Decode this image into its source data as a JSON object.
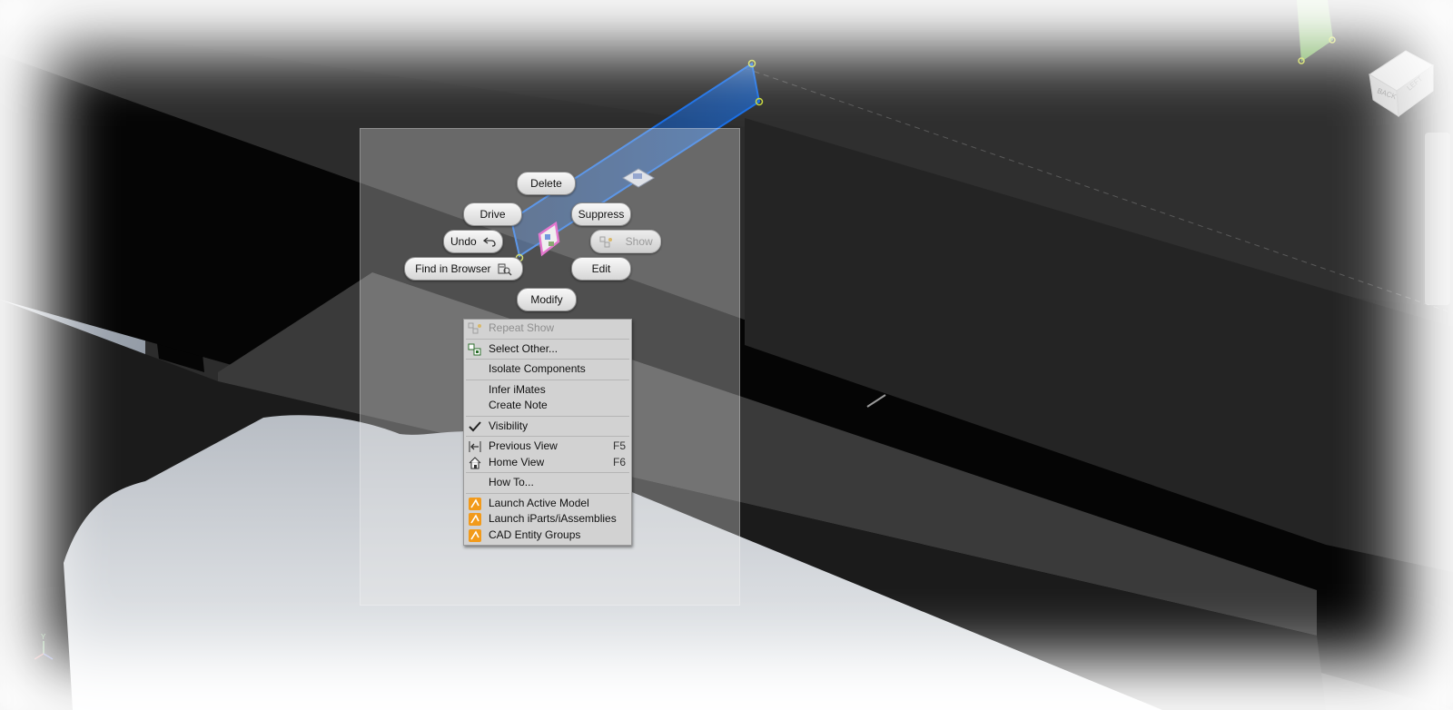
{
  "marking_menu": {
    "delete": "Delete",
    "drive": "Drive",
    "suppress": "Suppress",
    "undo": "Undo",
    "show": "Show",
    "find_in_browser": "Find in Browser",
    "edit": "Edit",
    "modify": "Modify"
  },
  "context_menu": {
    "repeat_show": "Repeat Show",
    "select_other": "Select Other...",
    "isolate_components": "Isolate Components",
    "infer_imates": "Infer iMates",
    "create_note": "Create Note",
    "visibility": "Visibility",
    "previous_view": "Previous View",
    "previous_view_shortcut": "F5",
    "home_view": "Home View",
    "home_view_shortcut": "F6",
    "how_to": "How To...",
    "launch_active_model": "Launch Active Model",
    "launch_iparts": "Launch iParts/iAssemblies",
    "cad_entity_groups": "CAD Entity Groups"
  },
  "viewcube": {
    "face_back": "BACK",
    "face_left": "LEFT"
  },
  "triad": {
    "y_label": "Y"
  },
  "colors": {
    "selection_blue": "#1a6fe6",
    "highlight_magenta": "#e040c0",
    "accent_orange": "#f29a1a",
    "green_plane": "#7bc15a"
  }
}
